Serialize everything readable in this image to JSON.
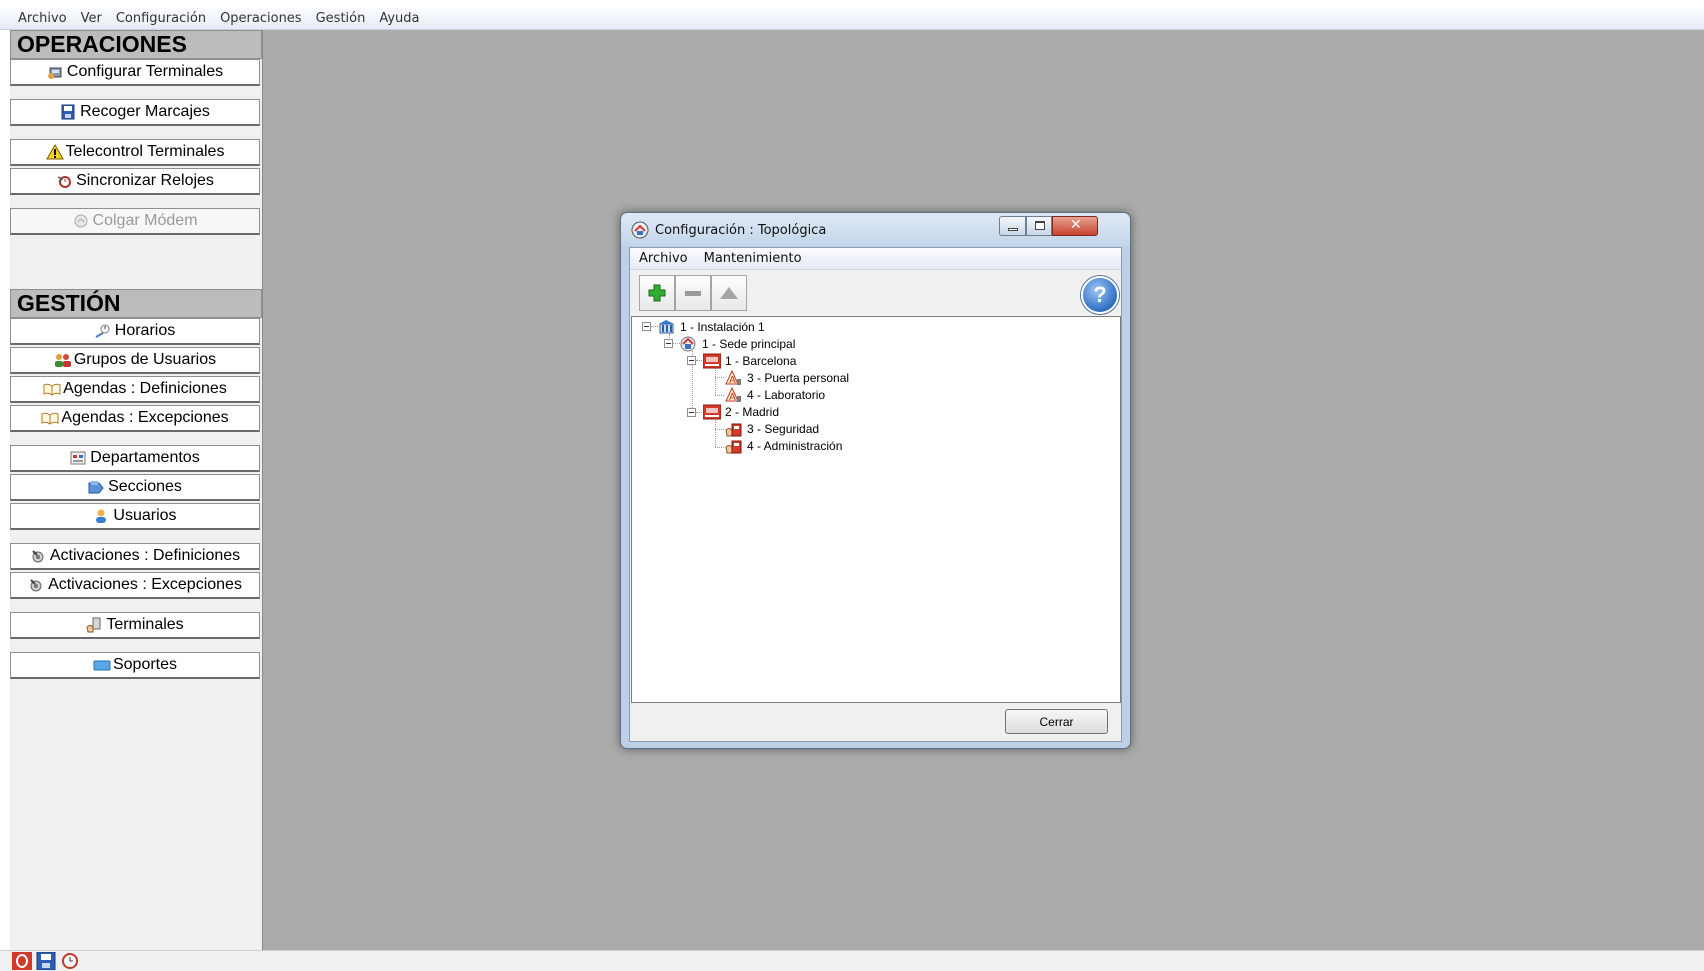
{
  "menubar": {
    "items": [
      "Archivo",
      "Ver",
      "Configuración",
      "Operaciones",
      "Gestión",
      "Ayuda"
    ]
  },
  "sidebar": {
    "operaciones": {
      "heading": "OPERACIONES",
      "buttons": [
        {
          "label": "Configurar Terminales",
          "icon": "terminal-config-icon"
        },
        {
          "label": "Recoger Marcajes",
          "icon": "floppy-disk-icon"
        },
        {
          "label": "Telecontrol Terminales",
          "icon": "warning-icon"
        },
        {
          "label": "Sincronizar Relojes",
          "icon": "clock-sync-icon"
        },
        {
          "label": "Colgar Módem",
          "icon": "modem-icon",
          "disabled": true
        }
      ]
    },
    "gestion": {
      "heading": "GESTIÓN",
      "buttons": [
        {
          "label": "Horarios",
          "icon": "schedule-icon"
        },
        {
          "label": "Grupos de Usuarios",
          "icon": "user-group-icon"
        },
        {
          "label": "Agendas : Definiciones",
          "icon": "agenda-icon"
        },
        {
          "label": "Agendas : Excepciones",
          "icon": "agenda-icon"
        },
        {
          "label": "Departamentos",
          "icon": "department-icon"
        },
        {
          "label": "Secciones",
          "icon": "section-icon"
        },
        {
          "label": "Usuarios",
          "icon": "user-icon"
        },
        {
          "label": "Activaciones : Definiciones",
          "icon": "activation-icon"
        },
        {
          "label": "Activaciones : Excepciones",
          "icon": "activation-icon"
        },
        {
          "label": "Terminales",
          "icon": "terminal-hand-icon"
        },
        {
          "label": "Soportes",
          "icon": "card-icon"
        }
      ]
    }
  },
  "dialog": {
    "title": "Configuración : Topológica",
    "menu": [
      "Archivo",
      "Mantenimiento"
    ],
    "toolbar": {
      "add": "add-icon",
      "remove": "remove-icon",
      "up": "move-up-icon",
      "help": "?"
    },
    "tree": [
      {
        "label": "1 - Instalación 1",
        "icon": "installation-icon"
      },
      {
        "label": "1 - Sede principal",
        "icon": "headquarters-icon"
      },
      {
        "label": "1 - Barcelona",
        "icon": "site-icon"
      },
      {
        "label": "3 - Puerta personal",
        "icon": "door-terminal-icon"
      },
      {
        "label": "4 - Laboratorio",
        "icon": "door-terminal-icon"
      },
      {
        "label": "2 - Madrid",
        "icon": "site-icon"
      },
      {
        "label": "3 - Seguridad",
        "icon": "reader-terminal-icon"
      },
      {
        "label": "4 - Administración",
        "icon": "reader-terminal-icon"
      }
    ],
    "close_button": "Cerrar"
  },
  "colors": {
    "workspace": "#ababab",
    "section_header": "#bcbcbc",
    "dialog_frame": "#bcd0e6"
  }
}
